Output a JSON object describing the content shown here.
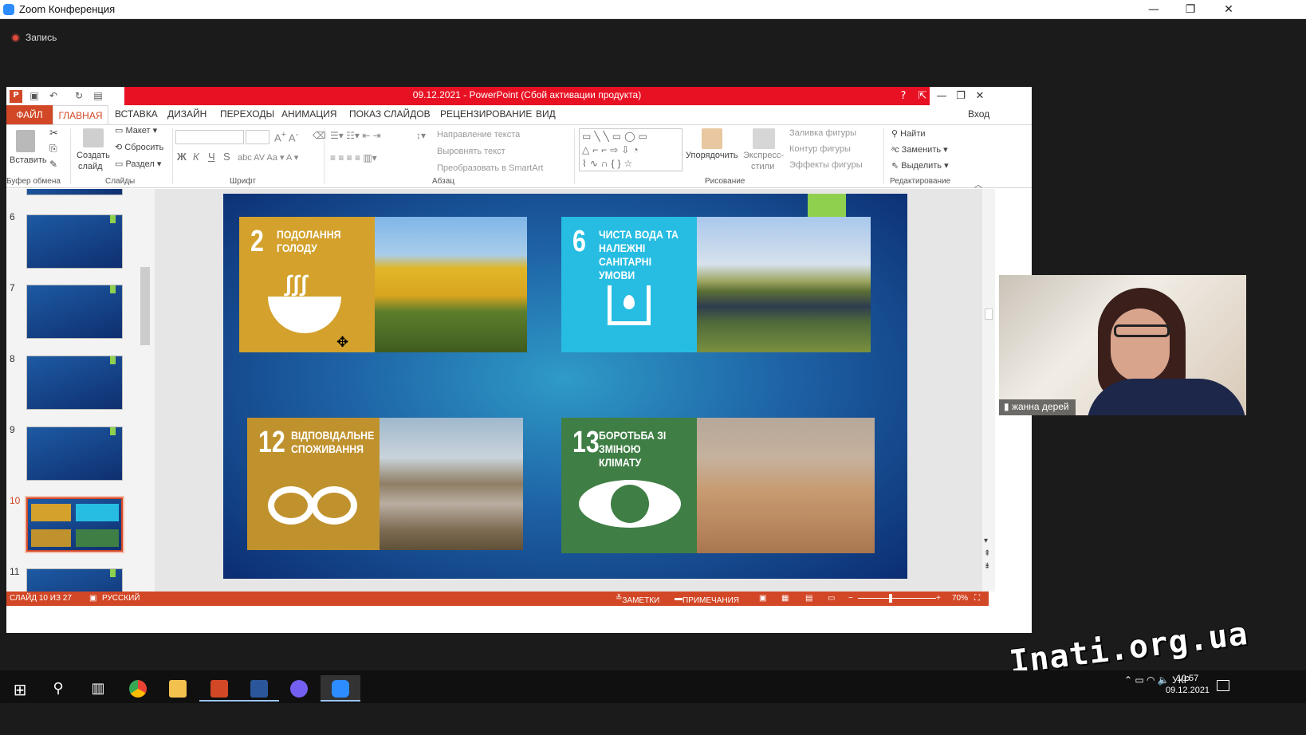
{
  "zoom": {
    "title": "Zoom Конференция",
    "record_label": "Запись",
    "participant_name": "жанна дерей"
  },
  "ppt": {
    "title": "09.12.2021 -  PowerPoint (Сбой активации продукта)",
    "account": "Вход",
    "tabs": [
      "ФАЙЛ",
      "ГЛАВНАЯ",
      "ВСТАВКА",
      "ДИЗАЙН",
      "ПЕРЕХОДЫ",
      "АНИМАЦИЯ",
      "ПОКАЗ СЛАЙДОВ",
      "РЕЦЕНЗИРОВАНИЕ",
      "ВИД"
    ],
    "ribbon": {
      "paste": "Вставить",
      "new_slide_1": "Создать",
      "new_slide_2": "слайд",
      "layout": "Макет",
      "reset": "Сбросить",
      "section": "Раздел",
      "font_bold": "Ж",
      "font_italic": "К",
      "font_underline": "Ч",
      "font_strike": "S",
      "text_direction": "Направление текста",
      "align_text": "Выровнять текст",
      "convert_smartart": "Преобразовать в SmartArt",
      "arrange": "Упорядочить",
      "quick_styles_1": "Экспресс-",
      "quick_styles_2": "стили",
      "shape_fill": "Заливка фигуры",
      "shape_outline": "Контур фигуры",
      "shape_effects": "Эффекты фигуры",
      "find": "Найти",
      "replace": "Заменить",
      "select": "Выделить",
      "groups": {
        "clipboard": "Буфер обмена",
        "slides": "Слайды",
        "font": "Шрифт",
        "paragraph": "Абзац",
        "drawing": "Рисование",
        "editing": "Редактирование"
      }
    },
    "thumbnails": [
      "6",
      "7",
      "8",
      "9",
      "10",
      "11"
    ],
    "active_slide": "10",
    "status": {
      "slide": "СЛАЙД 10 ИЗ 27",
      "language": "РУССКИЙ",
      "notes": "ЗАМЕТКИ",
      "comments": "ПРИМЕЧАНИЯ",
      "zoom": "70%",
      "zoom_level": 0.7
    }
  },
  "slide": {
    "goals": [
      {
        "number": "2",
        "text": "ПОДОЛАННЯ ГОЛОДУ",
        "color": "#d3a12c"
      },
      {
        "number": "6",
        "text": "ЧИСТА ВОДА ТА НАЛЕЖНІ САНІТАРНІ УМОВИ",
        "color": "#27bde2"
      },
      {
        "number": "12",
        "text": "ВІДПОВІДАЛЬНЕ СПОЖИВАННЯ",
        "color": "#c0922e"
      },
      {
        "number": "13",
        "text": "БОРОТЬБА ЗІ ЗМІНОЮ КЛІМАТУ",
        "color": "#3f7e44"
      }
    ]
  },
  "taskbar": {
    "lang": "УКР",
    "time": "10:57",
    "date": "09.12.2021"
  },
  "watermark": "Inati.org.ua"
}
